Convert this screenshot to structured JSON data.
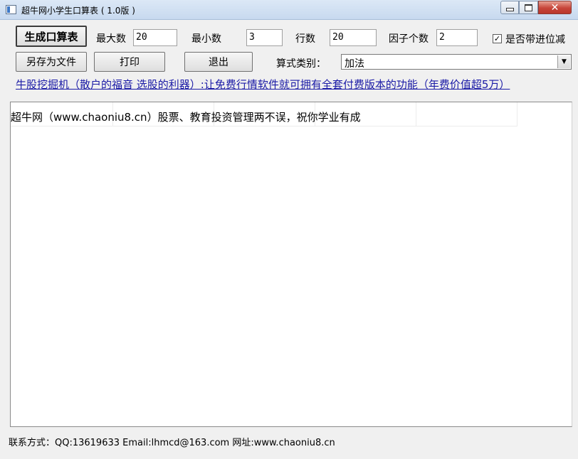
{
  "window": {
    "title": "超牛网小学生口算表 ( 1.0版 )",
    "close_glyph": "✕"
  },
  "toolbar": {
    "generate_label": "生成口算表",
    "save_as_label": "另存为文件",
    "print_label": "打印",
    "exit_label": "退出"
  },
  "params": {
    "max_label": "最大数",
    "max_value": "20",
    "min_label": "最小数",
    "min_value": "3",
    "rows_label": "行数",
    "rows_value": "20",
    "factors_label": "因子个数",
    "factors_value": "2",
    "carry_label": "是否带进位减",
    "carry_checked": true,
    "carry_mark": "✓",
    "formula_type_label": "算式类别：",
    "formula_type_value": "加法",
    "combo_arrow": "▼"
  },
  "promo": {
    "text": "牛股挖掘机（散户的福音 选股的利器）:让免费行情软件就可拥有全套付费版本的功能（年费价值超5万）"
  },
  "output": {
    "lines": [
      "超牛网（www.chaoniu8.cn）股票、教育投资管理两不误，祝你学业有成"
    ]
  },
  "footer": {
    "text": "联系方式：QQ:13619633  Email:lhmcd@163.com 网址:www.chaoniu8.cn"
  }
}
